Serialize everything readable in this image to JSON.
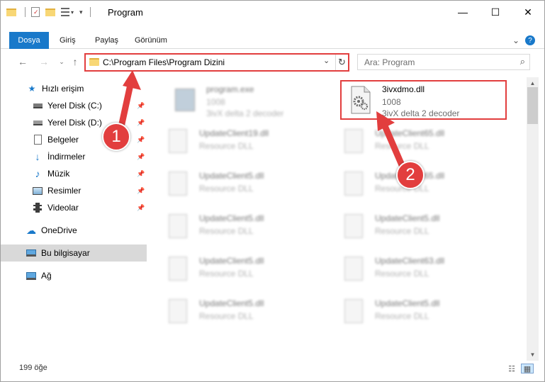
{
  "window": {
    "title": "Program",
    "controls": {
      "minimize": "—",
      "maximize": "☐",
      "close": "✕"
    }
  },
  "ribbon": {
    "file_tab": "Dosya",
    "tabs": [
      "Giriş",
      "Paylaş",
      "Görünüm"
    ],
    "expand": "⌄",
    "help": "?"
  },
  "address_bar": {
    "path": "C:\\Program Files\\Program Dizini",
    "refresh": "↻"
  },
  "search": {
    "placeholder": "Ara: Program"
  },
  "nav": {
    "quick_access": "Hızlı erişim",
    "items": [
      "Yerel Disk (C:)",
      "Yerel Disk (D:)",
      "Belgeler",
      "İndirmeler",
      "Müzik",
      "Resimler",
      "Videolar"
    ],
    "onedrive": "OneDrive",
    "this_pc": "Bu bilgisayar",
    "network": "Ağ"
  },
  "files": {
    "highlighted": {
      "name": "3ivxdmo.dll",
      "version": "1008",
      "description": "3ivX delta 2 decoder"
    },
    "exe": {
      "name": "program.exe",
      "version": "1008",
      "description": "3ivX delta 2 decoder"
    },
    "blurred": [
      {
        "name": "UpdateClient19.dll",
        "description": "Resource DLL"
      },
      {
        "name": "UpdateClient65.dll",
        "description": "Resource DLL"
      },
      {
        "name": "UpdateClient5.dll",
        "description": "Resource DLL"
      },
      {
        "name": "UpdateClient65.dll",
        "description": "Resource DLL"
      },
      {
        "name": "UpdateClient5.dll",
        "description": "Resource DLL"
      },
      {
        "name": "UpdateClient5.dll",
        "description": "Resource DLL"
      },
      {
        "name": "UpdateClient5.dll",
        "description": "Resource DLL"
      },
      {
        "name": "UpdateClient63.dll",
        "description": "Resource DLL"
      },
      {
        "name": "UpdateClient5.dll",
        "description": "Resource DLL"
      },
      {
        "name": "UpdateClient5.dll",
        "description": "Resource DLL"
      }
    ]
  },
  "callouts": {
    "one": "1",
    "two": "2"
  },
  "status": {
    "item_count": "199 öğe"
  },
  "colors": {
    "accent": "#1979ca",
    "callout": "#e23e3e",
    "selection": "#d9d9d9"
  }
}
